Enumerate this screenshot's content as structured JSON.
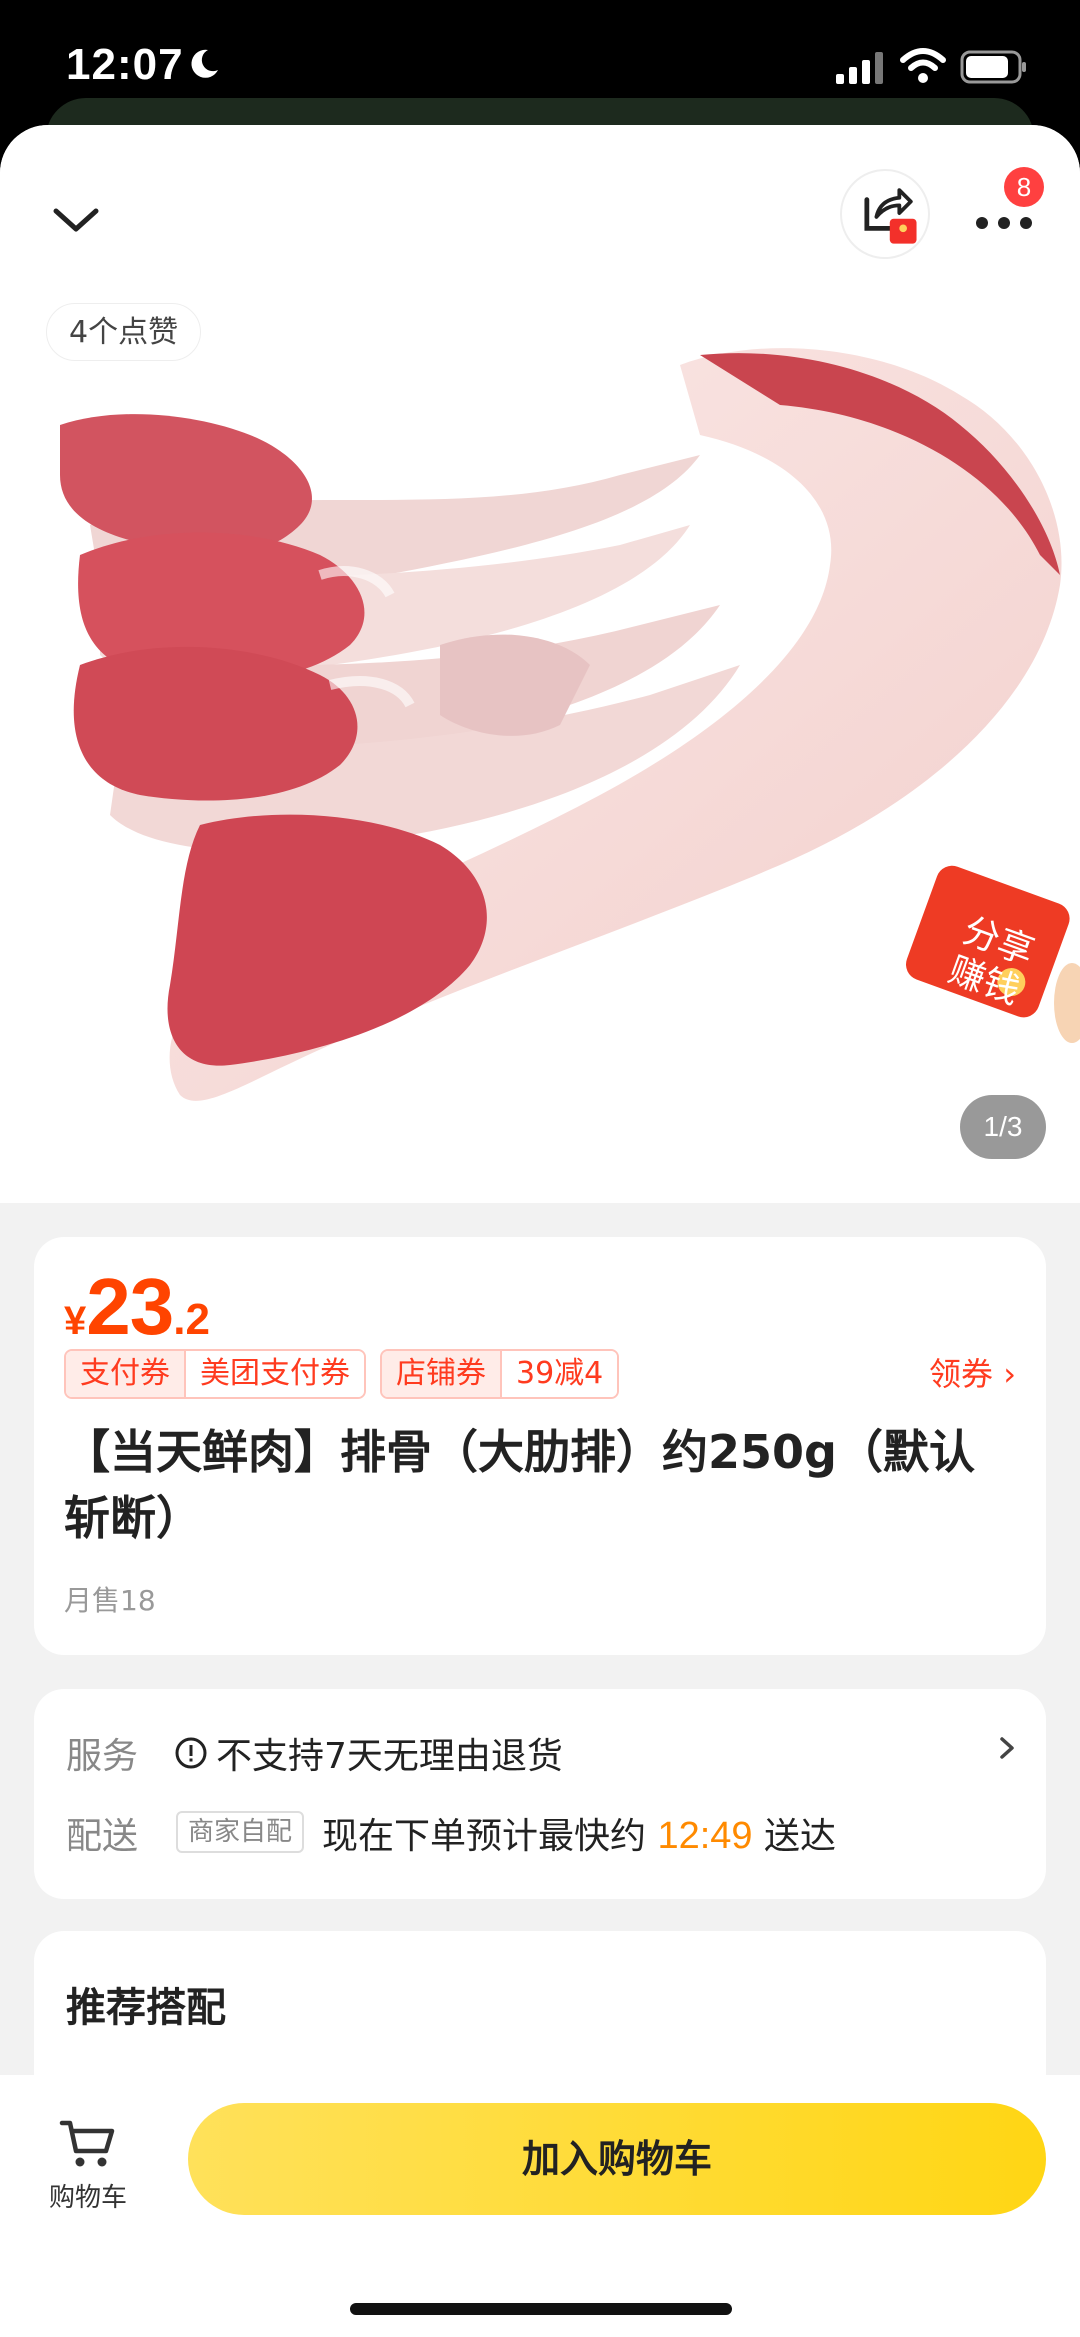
{
  "status": {
    "time": "12:07"
  },
  "header": {
    "notification_count": "8"
  },
  "gallery": {
    "likes": "4个点赞",
    "counter": "1/3",
    "share_earn_line1": "分享",
    "share_earn_line2": "赚钱"
  },
  "product": {
    "currency": "¥",
    "price_int": "23",
    "price_dec": ".2",
    "coupons": [
      {
        "label": "支付券",
        "value": "美团支付券"
      },
      {
        "label": "店铺券",
        "value": "39减4"
      }
    ],
    "get_coupon": "领券 ›",
    "title": "【当天鲜肉】排骨（大肋排）约250g（默认斩断）",
    "monthly_sales": "月售18"
  },
  "service": {
    "service_label": "服务",
    "service_text": "不支持7天无理由退货",
    "delivery_label": "配送",
    "delivery_tag": "商家自配",
    "delivery_prefix": "现在下单预计最快约",
    "delivery_time": "12:49",
    "delivery_suffix": "送达"
  },
  "recommend": {
    "title": "推荐搭配"
  },
  "bottom": {
    "cart_label": "购物车",
    "add_to_cart": "加入购物车"
  },
  "colors": {
    "accent_price": "#ff4400",
    "coupon_red": "#ff3b1f",
    "time_orange": "#ff8a00",
    "button_yellow": "#ffd614"
  }
}
